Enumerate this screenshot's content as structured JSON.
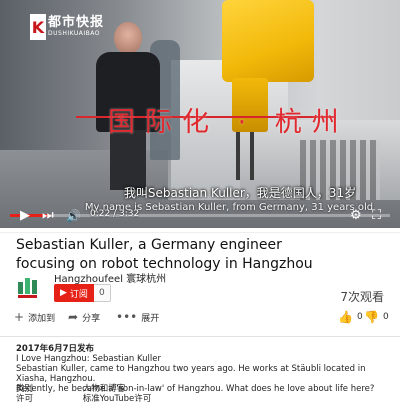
{
  "player": {
    "logo_mark": "K",
    "logo_cn": "都市快报",
    "logo_en": "DUSHIKUAIBAO",
    "overlay_text": "国际化 · 杭州",
    "subtitle_cn": "我叫Sebastian Kuller，我是德国人，31岁",
    "subtitle_en": "My name is Sebastian Kuller, from Germany, 31 years old",
    "time": "0:22 / 3:32",
    "progress": 0.104,
    "accent": "#e62117"
  },
  "video": {
    "title": "Sebastian Kuller, a Germany engineer focusing on robot technology in Hangzhou",
    "channel_name": "Hangzhoufeel 寰球杭州",
    "subscribe_label": "订阅",
    "subscribe_count": "0",
    "views": "7次观看"
  },
  "actions": {
    "add_label": "添加到",
    "share_label": "分享",
    "more_label": "展开",
    "like_count": "0",
    "dislike_count": "0"
  },
  "description": {
    "published": "2017年6月7日发布",
    "line1": "I Love Hangzhou: Sebastian Kuller",
    "line2": "Sebastian Kuller, came to Hangzhou two years ago. He works at Stäubli located in Xiasha, Hangzhou.",
    "line3": "Recently, he became a 'son-in-law' of Hangzhou. What does he love about life here?",
    "category_key": "类别",
    "category_value": "人物和博客",
    "license_key": "许可",
    "license_value": "标准YouTube许可"
  }
}
